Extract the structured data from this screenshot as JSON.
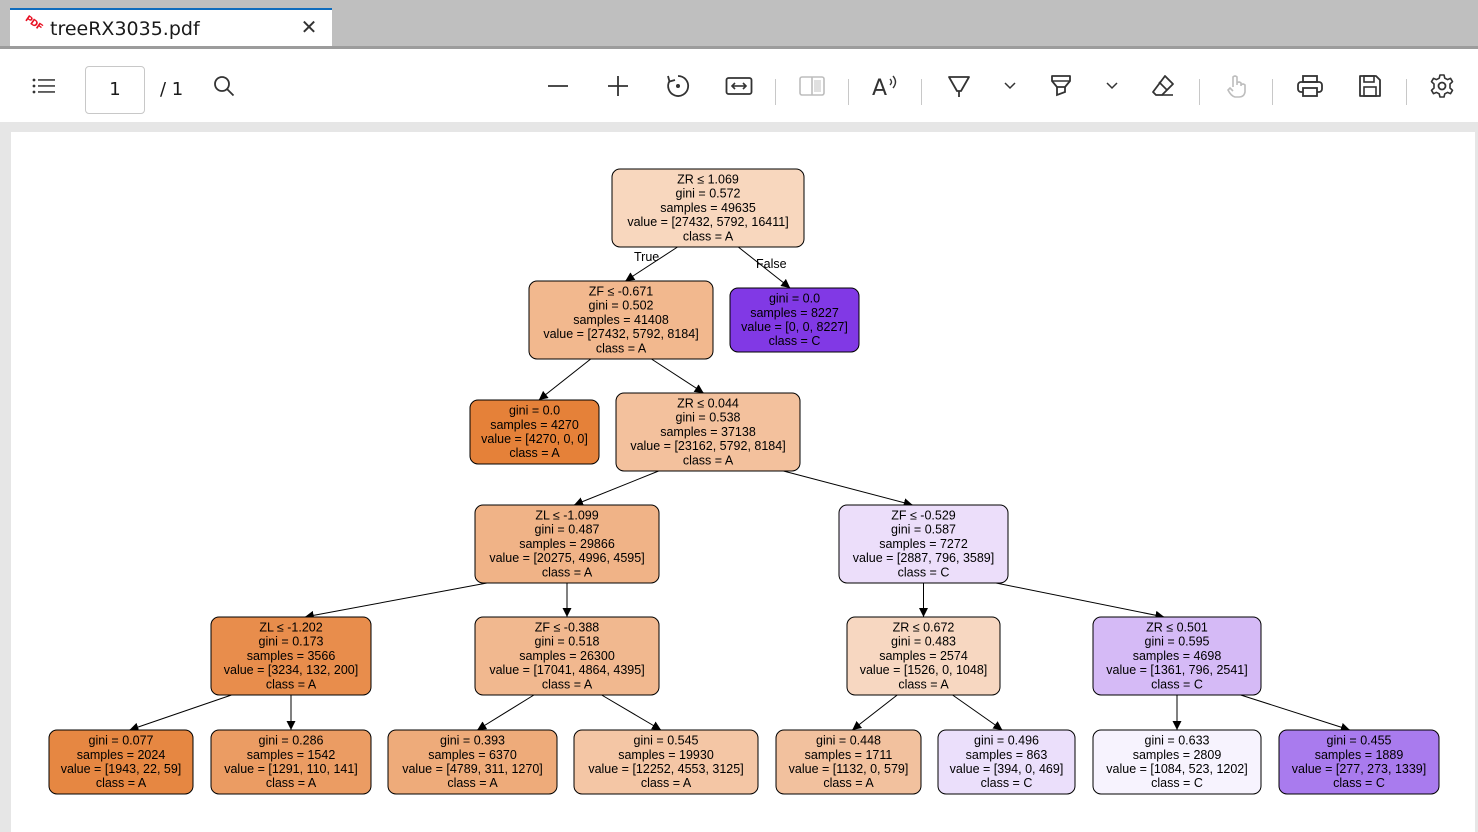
{
  "tab": {
    "title": "treeRX3035.pdf",
    "icon": "pdf-icon",
    "close_glyph": "✕",
    "pdf_mark": "PDF"
  },
  "toolbar": {
    "page_current": "1",
    "page_total": "/ 1",
    "items": [
      "contents-icon",
      "search-icon",
      "zoom-out-icon",
      "zoom-in-icon",
      "rotate-icon",
      "fit-width-icon",
      "page-view-icon",
      "read-aloud-icon",
      "draw-icon",
      "draw-options-icon",
      "highlight-icon",
      "highlight-options-icon",
      "erase-icon",
      "touch-icon",
      "print-icon",
      "save-icon",
      "settings-icon"
    ],
    "read_aloud_label": "A"
  },
  "tree": {
    "colors": {
      "orange": "#e58139",
      "purple": "#8139e5"
    },
    "edge_labels": {
      "true": "True",
      "false": "False"
    },
    "nodes": [
      {
        "id": "n0",
        "lines": [
          "ZR ≤ 1.069",
          "gini = 0.572",
          "samples = 49635",
          "value = [27432, 5792, 16411]",
          "class = A"
        ],
        "fill": "#f8d7be"
      },
      {
        "id": "n1",
        "lines": [
          "ZF ≤ -0.671",
          "gini = 0.502",
          "samples = 41408",
          "value = [27432, 5792, 8184]",
          "class = A"
        ],
        "fill": "#f2b88e"
      },
      {
        "id": "n2",
        "lines": [
          "gini = 0.0",
          "samples = 8227",
          "value = [0, 0, 8227]",
          "class = C"
        ],
        "fill": "#8139e5"
      },
      {
        "id": "n3",
        "lines": [
          "gini = 0.0",
          "samples = 4270",
          "value = [4270, 0, 0]",
          "class = A"
        ],
        "fill": "#e58139"
      },
      {
        "id": "n4",
        "lines": [
          "ZR ≤ 0.044",
          "gini = 0.538",
          "samples = 37138",
          "value = [23162, 5792, 8184]",
          "class = A"
        ],
        "fill": "#f3c19d"
      },
      {
        "id": "n5",
        "lines": [
          "ZL ≤ -1.099",
          "gini = 0.487",
          "samples = 29866",
          "value = [20275, 4996, 4595]",
          "class = A"
        ],
        "fill": "#f0b387"
      },
      {
        "id": "n6",
        "lines": [
          "ZF ≤ -0.529",
          "gini = 0.587",
          "samples = 7272",
          "value = [2887, 796, 3589]",
          "class = C"
        ],
        "fill": "#ecdefa"
      },
      {
        "id": "n7",
        "lines": [
          "ZL ≤ -1.202",
          "gini = 0.173",
          "samples = 3566",
          "value = [3234, 132, 200]",
          "class = A"
        ],
        "fill": "#e88d4c"
      },
      {
        "id": "n8",
        "lines": [
          "ZF ≤ -0.388",
          "gini = 0.518",
          "samples = 26300",
          "value = [17041, 4864, 4395]",
          "class = A"
        ],
        "fill": "#f1b88f"
      },
      {
        "id": "n9",
        "lines": [
          "ZR ≤ 0.672",
          "gini = 0.483",
          "samples = 2574",
          "value = [1526, 0, 1048]",
          "class = A"
        ],
        "fill": "#f7d7c1"
      },
      {
        "id": "n10",
        "lines": [
          "ZR ≤ 0.501",
          "gini = 0.595",
          "samples = 4698",
          "value = [1361, 796, 2541]",
          "class = C"
        ],
        "fill": "#d5baf6"
      },
      {
        "id": "n11",
        "lines": [
          "gini = 0.077",
          "samples = 2024",
          "value = [1943, 22, 59]",
          "class = A"
        ],
        "fill": "#e68742"
      },
      {
        "id": "n12",
        "lines": [
          "gini = 0.286",
          "samples = 1542",
          "value = [1291, 110, 141]",
          "class = A"
        ],
        "fill": "#eb9c63"
      },
      {
        "id": "n13",
        "lines": [
          "gini = 0.393",
          "samples = 6370",
          "value = [4789, 311, 1270]",
          "class = A"
        ],
        "fill": "#eeab7a"
      },
      {
        "id": "n14",
        "lines": [
          "gini = 0.545",
          "samples = 19930",
          "value = [12252, 4553, 3125]",
          "class = A"
        ],
        "fill": "#f4c6a5"
      },
      {
        "id": "n15",
        "lines": [
          "gini = 0.448",
          "samples = 1711",
          "value = [1132, 0, 579]",
          "class = A"
        ],
        "fill": "#f2c19e"
      },
      {
        "id": "n16",
        "lines": [
          "gini = 0.496",
          "samples = 863",
          "value = [394, 0, 469]",
          "class = C"
        ],
        "fill": "#ebdffb"
      },
      {
        "id": "n17",
        "lines": [
          "gini = 0.633",
          "samples = 2809",
          "value = [1084, 523, 1202]",
          "class = C"
        ],
        "fill": "#f7f3fe"
      },
      {
        "id": "n18",
        "lines": [
          "gini = 0.455",
          "samples = 1889",
          "value = [277, 273, 1339]",
          "class = C"
        ],
        "fill": "#a97bee"
      }
    ],
    "edges": [
      {
        "from": "n0",
        "to": "n1",
        "label": "true"
      },
      {
        "from": "n0",
        "to": "n2",
        "label": "false"
      },
      {
        "from": "n1",
        "to": "n3"
      },
      {
        "from": "n1",
        "to": "n4"
      },
      {
        "from": "n4",
        "to": "n5"
      },
      {
        "from": "n4",
        "to": "n6"
      },
      {
        "from": "n5",
        "to": "n7"
      },
      {
        "from": "n5",
        "to": "n8"
      },
      {
        "from": "n6",
        "to": "n9"
      },
      {
        "from": "n6",
        "to": "n10"
      },
      {
        "from": "n7",
        "to": "n11"
      },
      {
        "from": "n7",
        "to": "n12"
      },
      {
        "from": "n8",
        "to": "n13"
      },
      {
        "from": "n8",
        "to": "n14"
      },
      {
        "from": "n9",
        "to": "n15"
      },
      {
        "from": "n9",
        "to": "n16"
      },
      {
        "from": "n10",
        "to": "n17"
      },
      {
        "from": "n10",
        "to": "n18"
      }
    ]
  }
}
